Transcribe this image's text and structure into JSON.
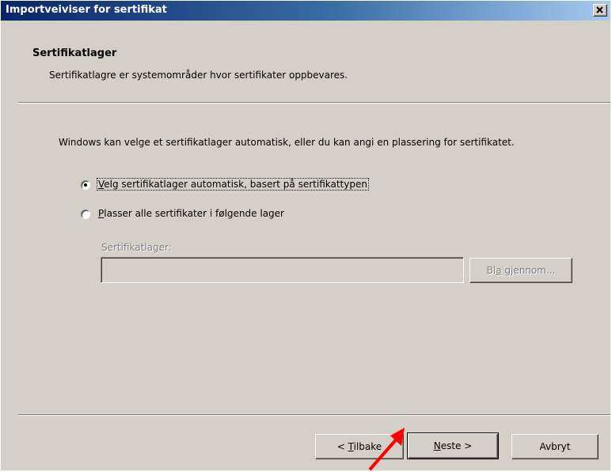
{
  "window": {
    "title": "Importveiviser for sertifikat",
    "close_icon": "close-icon"
  },
  "header": {
    "title": "Sertifikatlager",
    "subtitle": "Sertifikatlagre er systemområder hvor sertifikater oppbevares."
  },
  "body": {
    "description": "Windows kan velge et sertifikatlager automatisk, eller du kan angi en plassering for sertifikatet.",
    "options": [
      {
        "label": "Velg sertifikatlager automatisk, basert på sertifikattypen",
        "selected": true
      },
      {
        "label": "Plasser alle sertifikater i følgende lager",
        "selected": false
      }
    ],
    "store_label": "Sertifikatlager:",
    "store_value": "",
    "browse_label": "Bla gjennom..."
  },
  "footer": {
    "back_label": "< Tilbake",
    "next_label": "Neste >",
    "cancel_label": "Avbryt"
  },
  "annotation": {
    "arrow_color": "#ff0000",
    "arrow_icon": "red-arrow-pointer"
  }
}
